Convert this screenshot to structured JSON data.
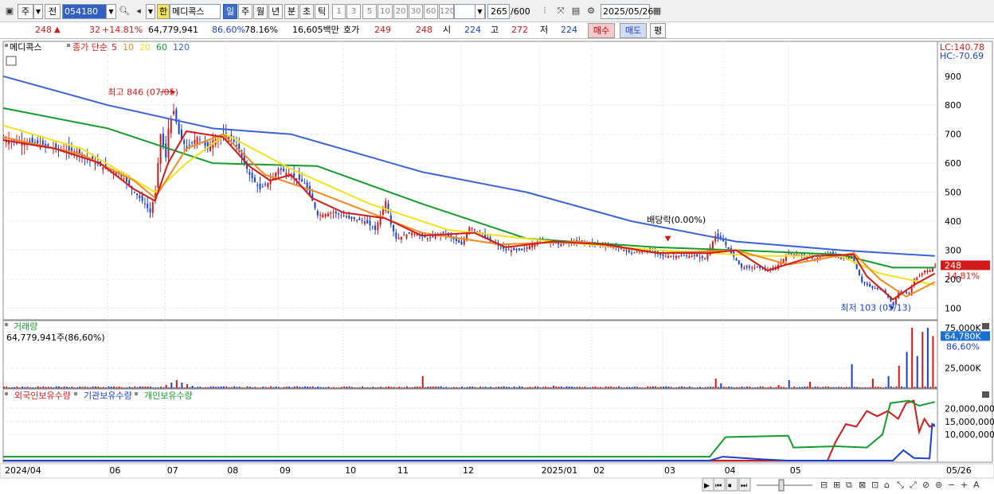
{
  "toolbar": {
    "type_btn": "주",
    "prev_btn": "전",
    "code": "054180",
    "han_btn": "한",
    "name": "메디콕스",
    "periods": [
      "일",
      "주",
      "월",
      "년",
      "분",
      "초",
      "틱"
    ],
    "minutes": [
      "1",
      "3",
      "5",
      "10",
      "20",
      "30",
      "60",
      "120"
    ],
    "count": "265",
    "count_total": "/600",
    "date": "2025/05/26"
  },
  "quote": {
    "price": "248",
    "arrow": "▲",
    "change": "32",
    "change_pct": "+14.81%",
    "volume": "64,779,941",
    "vol_ratio": "86.60%",
    "turnover": "78.16%",
    "amount": "16,605백만",
    "bid_label": "호가",
    "bid1": "249",
    "bid2": "248",
    "open_label": "시",
    "open": "224",
    "high_label": "고",
    "high": "272",
    "low_label": "저",
    "low": "224",
    "buy_btn": "매수",
    "sell_btn": "매도",
    "eval_btn": "평"
  },
  "colors": {
    "up": "#d21a1a",
    "down": "#1a3fd2",
    "ma5": "#d21a1a",
    "ma10": "#ee8a1e",
    "ma20": "#f3e21a",
    "ma60": "#169b2f",
    "ma120": "#3b63d8",
    "foreign": "#d21a1a",
    "inst": "#1a3fd2",
    "indiv": "#169b2f"
  },
  "chart_data": [
    {
      "type": "candlestick",
      "legend_name": "메디콕스",
      "legend_series": "종가 단순",
      "ma_periods": [
        "5",
        "10",
        "20",
        "60",
        "120"
      ],
      "ylim": [
        60,
        1020
      ],
      "y_ticks": [
        100,
        200,
        300,
        400,
        500,
        600,
        700,
        800
      ],
      "y_tick_labels": [
        "100",
        "200",
        "300",
        "400",
        "500",
        "600",
        "700",
        "800"
      ],
      "y_top_label": "900",
      "lc_label": "LC:140.78",
      "hc_label": "HC:-70.69",
      "last_price_label": "248",
      "last_pct_label": "14.81%",
      "high_annotation": "최고 846 (07/05)",
      "low_annotation": "최저 103 (05/13)",
      "dividend_annotation": "배당락(0.00%)",
      "x_labels": [
        "2024/04",
        "06",
        "07",
        "08",
        "09",
        "10",
        "11",
        "12",
        "2025/01",
        "02",
        "03",
        "04",
        "05",
        "05/26"
      ],
      "price_path": [
        [
          0,
          680
        ],
        [
          12,
          670
        ],
        [
          20,
          650
        ],
        [
          28,
          640
        ],
        [
          37,
          590
        ],
        [
          45,
          560
        ],
        [
          50,
          500
        ],
        [
          54,
          460
        ],
        [
          56,
          430
        ],
        [
          58,
          500
        ],
        [
          60,
          700
        ],
        [
          62,
          620
        ],
        [
          63,
          720
        ],
        [
          65,
          780
        ],
        [
          67,
          700
        ],
        [
          70,
          650
        ],
        [
          74,
          690
        ],
        [
          78,
          650
        ],
        [
          80,
          680
        ],
        [
          84,
          690
        ],
        [
          87,
          690
        ],
        [
          90,
          640
        ],
        [
          94,
          560
        ],
        [
          98,
          510
        ],
        [
          102,
          540
        ],
        [
          105,
          580
        ],
        [
          110,
          560
        ],
        [
          115,
          530
        ],
        [
          118,
          470
        ],
        [
          120,
          420
        ],
        [
          126,
          430
        ],
        [
          132,
          410
        ],
        [
          138,
          400
        ],
        [
          142,
          370
        ],
        [
          146,
          470
        ],
        [
          148,
          390
        ],
        [
          150,
          340
        ],
        [
          156,
          360
        ],
        [
          162,
          340
        ],
        [
          168,
          360
        ],
        [
          175,
          320
        ],
        [
          178,
          380
        ],
        [
          182,
          360
        ],
        [
          186,
          330
        ],
        [
          192,
          300
        ],
        [
          198,
          300
        ],
        [
          206,
          340
        ],
        [
          212,
          320
        ],
        [
          220,
          330
        ],
        [
          228,
          320
        ],
        [
          234,
          310
        ],
        [
          240,
          290
        ],
        [
          246,
          300
        ],
        [
          252,
          280
        ],
        [
          258,
          280
        ],
        [
          264,
          280
        ],
        [
          268,
          270
        ],
        [
          272,
          350
        ],
        [
          275,
          330
        ],
        [
          278,
          290
        ],
        [
          282,
          240
        ],
        [
          288,
          240
        ],
        [
          294,
          230
        ],
        [
          300,
          290
        ],
        [
          306,
          280
        ],
        [
          310,
          270
        ],
        [
          316,
          290
        ],
        [
          320,
          270
        ],
        [
          324,
          280
        ],
        [
          328,
          190
        ],
        [
          332,
          170
        ],
        [
          336,
          165
        ],
        [
          340,
          110
        ],
        [
          342,
          160
        ],
        [
          346,
          150
        ],
        [
          348,
          200
        ],
        [
          350,
          210
        ],
        [
          352,
          230
        ],
        [
          354,
          230
        ],
        [
          356,
          248
        ]
      ],
      "ma_paths": {
        "ma5": [
          [
            0,
            680
          ],
          [
            20,
            650
          ],
          [
            37,
            600
          ],
          [
            50,
            510
          ],
          [
            58,
            470
          ],
          [
            63,
            600
          ],
          [
            70,
            710
          ],
          [
            84,
            690
          ],
          [
            94,
            590
          ],
          [
            102,
            540
          ],
          [
            110,
            560
          ],
          [
            118,
            480
          ],
          [
            130,
            430
          ],
          [
            146,
            410
          ],
          [
            160,
            350
          ],
          [
            180,
            360
          ],
          [
            192,
            310
          ],
          [
            210,
            330
          ],
          [
            230,
            320
          ],
          [
            250,
            290
          ],
          [
            270,
            290
          ],
          [
            280,
            300
          ],
          [
            292,
            230
          ],
          [
            310,
            280
          ],
          [
            325,
            285
          ],
          [
            330,
            210
          ],
          [
            340,
            130
          ],
          [
            348,
            180
          ],
          [
            356,
            220
          ]
        ],
        "ma10": [
          [
            0,
            690
          ],
          [
            30,
            630
          ],
          [
            50,
            540
          ],
          [
            58,
            480
          ],
          [
            70,
            650
          ],
          [
            84,
            700
          ],
          [
            100,
            560
          ],
          [
            120,
            500
          ],
          [
            140,
            430
          ],
          [
            160,
            360
          ],
          [
            190,
            320
          ],
          [
            220,
            330
          ],
          [
            250,
            290
          ],
          [
            280,
            300
          ],
          [
            300,
            250
          ],
          [
            325,
            290
          ],
          [
            335,
            200
          ],
          [
            345,
            140
          ],
          [
            356,
            190
          ]
        ],
        "ma20": [
          [
            0,
            730
          ],
          [
            30,
            650
          ],
          [
            58,
            500
          ],
          [
            70,
            600
          ],
          [
            85,
            700
          ],
          [
            110,
            580
          ],
          [
            140,
            460
          ],
          [
            170,
            370
          ],
          [
            210,
            330
          ],
          [
            250,
            300
          ],
          [
            290,
            280
          ],
          [
            320,
            280
          ],
          [
            335,
            220
          ],
          [
            356,
            180
          ]
        ],
        "ma60": [
          [
            0,
            790
          ],
          [
            40,
            720
          ],
          [
            80,
            600
          ],
          [
            120,
            590
          ],
          [
            160,
            460
          ],
          [
            200,
            340
          ],
          [
            250,
            310
          ],
          [
            280,
            300
          ],
          [
            320,
            285
          ],
          [
            340,
            240
          ],
          [
            356,
            240
          ]
        ],
        "ma120": [
          [
            0,
            900
          ],
          [
            40,
            800
          ],
          [
            80,
            720
          ],
          [
            110,
            700
          ],
          [
            160,
            570
          ],
          [
            200,
            500
          ],
          [
            240,
            400
          ],
          [
            280,
            330
          ],
          [
            320,
            300
          ],
          [
            356,
            280
          ]
        ]
      }
    },
    {
      "type": "bar",
      "title": "거래량",
      "value_label": "64,779,941주(86,60%)",
      "y_tick_labels": [
        "25,000K",
        "75,000K"
      ],
      "last_label": "64,780K",
      "last_pct_label": "86,60%",
      "ylim": [
        0,
        80000000
      ],
      "bars": [
        [
          62,
          4000000
        ],
        [
          64,
          7000000
        ],
        [
          66,
          10000000
        ],
        [
          68,
          7000000
        ],
        [
          70,
          5000000
        ],
        [
          72,
          3000000
        ],
        [
          160,
          15000000
        ],
        [
          210,
          3000000
        ],
        [
          272,
          12000000
        ],
        [
          274,
          6000000
        ],
        [
          296,
          4000000
        ],
        [
          300,
          10000000
        ],
        [
          308,
          8000000
        ],
        [
          324,
          30000000
        ],
        [
          332,
          12000000
        ],
        [
          338,
          15000000
        ],
        [
          342,
          28000000
        ],
        [
          345,
          45000000
        ],
        [
          347,
          75000000
        ],
        [
          349,
          40000000
        ],
        [
          351,
          70000000
        ],
        [
          353,
          75000000
        ],
        [
          355,
          64780000
        ]
      ]
    },
    {
      "type": "line",
      "series": [
        {
          "name": "외국인보유수량",
          "points": [
            [
              0,
              0
            ],
            [
              270,
              0
            ],
            [
              315,
              0
            ],
            [
              318,
              7000000
            ],
            [
              322,
              14000000
            ],
            [
              326,
              13000000
            ],
            [
              330,
              19000000
            ],
            [
              334,
              17000000
            ],
            [
              338,
              19000000
            ],
            [
              342,
              16000000
            ],
            [
              345,
              22000000
            ],
            [
              348,
              23000000
            ],
            [
              350,
              11000000
            ],
            [
              352,
              16000000
            ],
            [
              354,
              13000000
            ],
            [
              356,
              14000000
            ]
          ]
        },
        {
          "name": "기관보유수량",
          "points": [
            [
              0,
              0
            ],
            [
              270,
              0
            ],
            [
              275,
              1500000
            ],
            [
              290,
              500000
            ],
            [
              300,
              0
            ],
            [
              340,
              0
            ],
            [
              344,
              4000000
            ],
            [
              348,
              1000000
            ],
            [
              354,
              800000
            ],
            [
              355,
              14000000
            ],
            [
              356,
              13000000
            ]
          ]
        },
        {
          "name": "개인보유수량",
          "points": [
            [
              0,
              1500000
            ],
            [
              270,
              1500000
            ],
            [
              276,
              9000000
            ],
            [
              300,
              9500000
            ],
            [
              302,
              5000000
            ],
            [
              318,
              5500000
            ],
            [
              330,
              5000000
            ],
            [
              336,
              10000000
            ],
            [
              339,
              22000000
            ],
            [
              346,
              23000000
            ],
            [
              350,
              21000000
            ],
            [
              354,
              22000000
            ],
            [
              356,
              22500000
            ]
          ]
        }
      ],
      "ylim": [
        0,
        25000000
      ],
      "y_tick_labels": [
        "10,000,000",
        "15,000,000",
        "20,000,000"
      ]
    }
  ]
}
